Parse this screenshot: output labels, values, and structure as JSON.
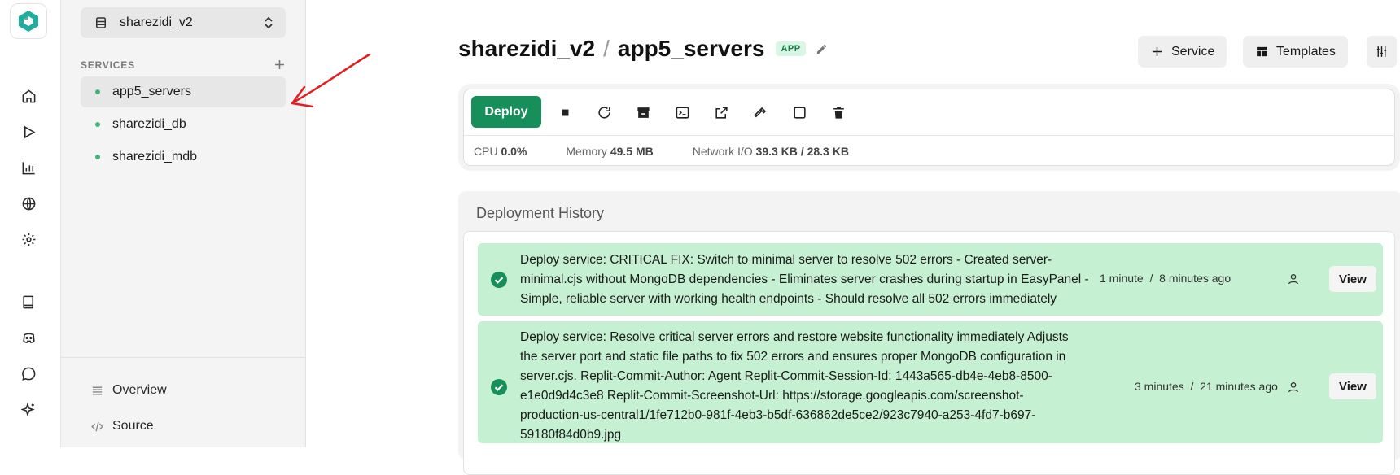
{
  "sidebar": {
    "project": "sharezidi_v2",
    "section_label": "SERVICES",
    "services": [
      {
        "label": "app5_servers",
        "active": true
      },
      {
        "label": "sharezidi_db",
        "active": false
      },
      {
        "label": "sharezidi_mdb",
        "active": false
      }
    ],
    "links": [
      {
        "label": "Overview",
        "icon": "list-icon"
      },
      {
        "label": "Source",
        "icon": "code-icon"
      }
    ]
  },
  "rail": {
    "icons": [
      "home-icon",
      "play-icon",
      "chart-icon",
      "globe-icon",
      "gear-icon",
      "book-icon",
      "discord-icon",
      "chat-icon",
      "sparkle-icon"
    ]
  },
  "header": {
    "project": "sharezidi_v2",
    "separator": "/",
    "service": "app5_servers",
    "badge": "APP",
    "service_button": "Service",
    "templates_button": "Templates"
  },
  "deploy": {
    "button": "Deploy",
    "tools": [
      "stop-icon",
      "restart-icon",
      "archive-icon",
      "terminal-icon",
      "external-link-icon",
      "hammer-icon",
      "square-icon",
      "trash-icon"
    ],
    "cpu_label": "CPU",
    "cpu_value": "0.0%",
    "memory_label": "Memory",
    "memory_value": "49.5 MB",
    "network_label": "Network I/O",
    "network_value": "39.3 KB / 28.3 KB"
  },
  "history": {
    "title": "Deployment History",
    "entries": [
      {
        "lines": [
          "Deploy service: CRITICAL FIX: Switch to minimal server to resolve 502 errors - Created server-",
          "minimal.cjs without MongoDB dependencies - Eliminates server crashes during startup in EasyPanel -",
          "Simple, reliable server with working health endpoints - Should resolve all 502 errors immediately"
        ],
        "duration": "1 minute",
        "ago": "8 minutes ago",
        "view": "View"
      },
      {
        "lines": [
          "Deploy service: Resolve critical server errors and restore website functionality immediately Adjusts",
          "the server port and static file paths to fix 502 errors and ensures proper MongoDB configuration in",
          "server.cjs. Replit-Commit-Author: Agent Replit-Commit-Session-Id: 1443a565-db4e-4eb8-8500-",
          "e1e0d9d4c3e8 Replit-Commit-Screenshot-Url: https://storage.googleapis.com/screenshot-",
          "production-us-central1/1fe712b0-981f-4eb3-b5df-636862de5ce2/923c7940-a253-4fd7-b697-",
          "59180f84d0b9.jpg"
        ],
        "duration": "3 minutes",
        "ago": "21 minutes ago",
        "view": "View"
      }
    ],
    "time_separator": "/"
  },
  "colors": {
    "accent": "#168f5a",
    "entry_bg": "#c5f1d2",
    "status_dot": "#3fb57a"
  }
}
